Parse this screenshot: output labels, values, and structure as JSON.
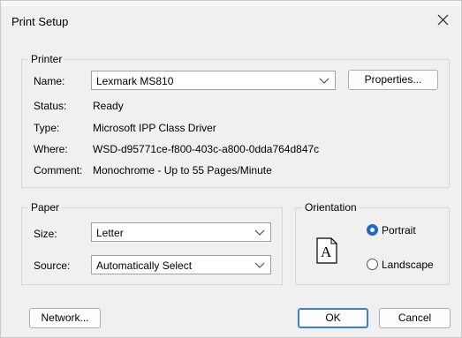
{
  "window": {
    "title": "Print Setup"
  },
  "printer": {
    "group_label": "Printer",
    "name_label": "Name:",
    "name_value": "Lexmark MS810",
    "properties_button": "Properties...",
    "status_label": "Status:",
    "status_value": "Ready",
    "type_label": "Type:",
    "type_value": "Microsoft IPP Class Driver",
    "where_label": "Where:",
    "where_value": "WSD-d95771ce-f800-403c-a800-0dda764d847c",
    "comment_label": "Comment:",
    "comment_value": "Monochrome - Up to 55 Pages/Minute"
  },
  "paper": {
    "group_label": "Paper",
    "size_label": "Size:",
    "size_value": "Letter",
    "source_label": "Source:",
    "source_value": "Automatically Select"
  },
  "orientation": {
    "group_label": "Orientation",
    "page_glyph": "A",
    "portrait_label": "Portrait",
    "landscape_label": "Landscape",
    "selected": "Portrait"
  },
  "footer": {
    "network_button": "Network...",
    "ok_button": "OK",
    "cancel_button": "Cancel"
  },
  "colors": {
    "accent": "#2168c6",
    "background": "#f0f0f0"
  }
}
